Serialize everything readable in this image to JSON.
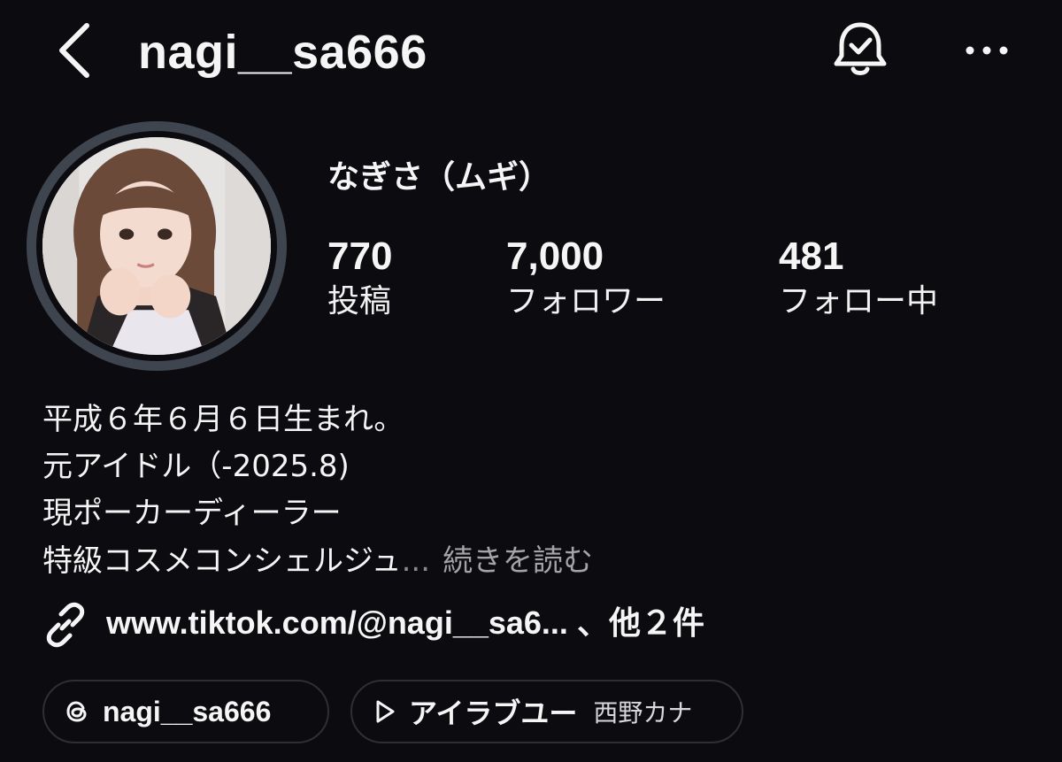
{
  "header": {
    "username": "nagi__sa666",
    "icons": {
      "back": "chevron-left-icon",
      "notifications": "bell-check-icon",
      "more": "more-horizontal-icon"
    }
  },
  "profile": {
    "display_name": "なぎさ（ムギ）",
    "stats": [
      {
        "value": "770",
        "label": "投稿"
      },
      {
        "value": "7,000",
        "label": "フォロワー"
      },
      {
        "value": "481",
        "label": "フォロー中"
      }
    ]
  },
  "bio": {
    "lines": [
      "平成６年６月６日生まれ。",
      "元アイドル（-2025.8)",
      "現ポーカーディーラー",
      "特級コスメコンシェルジュ"
    ],
    "ellipsis": "...",
    "read_more": "続きを読む"
  },
  "link": {
    "text": "www.tiktok.com/@nagi__sa6...",
    "extra": "、他２件"
  },
  "chips": {
    "threads": {
      "label": "nagi__sa666"
    },
    "music": {
      "song": "アイラブユー",
      "artist": "西野カナ"
    }
  },
  "colors": {
    "background": "#0c0c10",
    "text": "#f5f5f5",
    "muted": "#a3a3a8",
    "avatar_ring": "#3f454f",
    "chip_border": "#2e2f34"
  }
}
